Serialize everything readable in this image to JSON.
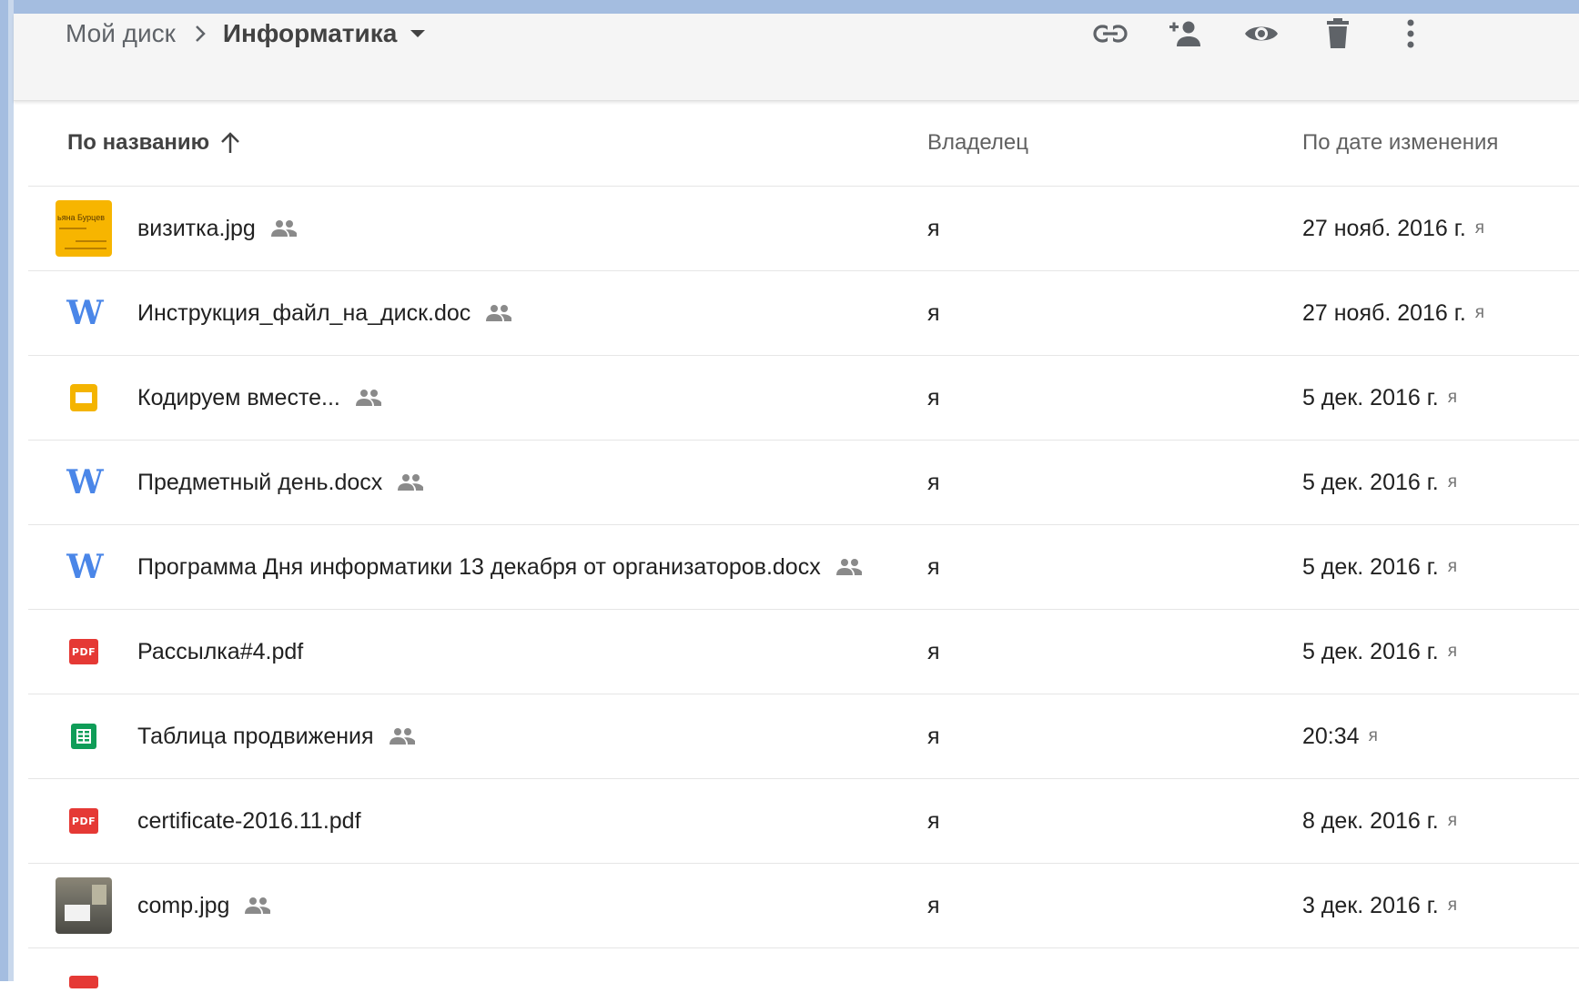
{
  "breadcrumb": {
    "root": "Мой диск",
    "current": "Информатика"
  },
  "toolbar": {
    "actions": [
      "link-icon",
      "add-person-icon",
      "preview-eye-icon",
      "trash-icon",
      "more-vert-icon"
    ]
  },
  "columns": {
    "name": "По названию",
    "owner": "Владелец",
    "modified": "По дате изменения"
  },
  "files": [
    {
      "name": "визитка.jpg",
      "type": "image-thumbnail",
      "shared": true,
      "owner": "я",
      "modified": "27 нояб. 2016 г.",
      "modified_by": "я",
      "thumb_text": "ьяна Бурцев"
    },
    {
      "name": "Инструкция_файл_на_диск.doc",
      "type": "word",
      "shared": true,
      "owner": "я",
      "modified": "27 нояб. 2016 г.",
      "modified_by": "я"
    },
    {
      "name": "Кодируем вместе...",
      "type": "slides",
      "shared": true,
      "owner": "я",
      "modified": "5 дек. 2016 г.",
      "modified_by": "я"
    },
    {
      "name": "Предметный день.docx",
      "type": "word",
      "shared": true,
      "owner": "я",
      "modified": "5 дек. 2016 г.",
      "modified_by": "я"
    },
    {
      "name": "Программа Дня информатики 13 декабря от организаторов.docx",
      "type": "word",
      "shared": true,
      "owner": "я",
      "modified": "5 дек. 2016 г.",
      "modified_by": "я"
    },
    {
      "name": "Рассылка#4.pdf",
      "type": "pdf",
      "shared": false,
      "owner": "я",
      "modified": "5 дек. 2016 г.",
      "modified_by": "я"
    },
    {
      "name": "Таблица продвижения",
      "type": "sheets",
      "shared": true,
      "owner": "я",
      "modified": "20:34",
      "modified_by": "я"
    },
    {
      "name": "certificate-2016.11.pdf",
      "type": "pdf",
      "shared": false,
      "owner": "я",
      "modified": "8 дек. 2016 г.",
      "modified_by": "я"
    },
    {
      "name": "comp.jpg",
      "type": "image-thumbnail",
      "shared": true,
      "owner": "я",
      "modified": "3 дек. 2016 г.",
      "modified_by": "я"
    }
  ],
  "icons": {
    "word_glyph": "W",
    "pdf_label": "PDF"
  },
  "colors": {
    "word": "#4a86e8",
    "pdf": "#e53935",
    "slides": "#f4b400",
    "sheets": "#0f9d58",
    "chrome_strip": "#a4bde0"
  }
}
